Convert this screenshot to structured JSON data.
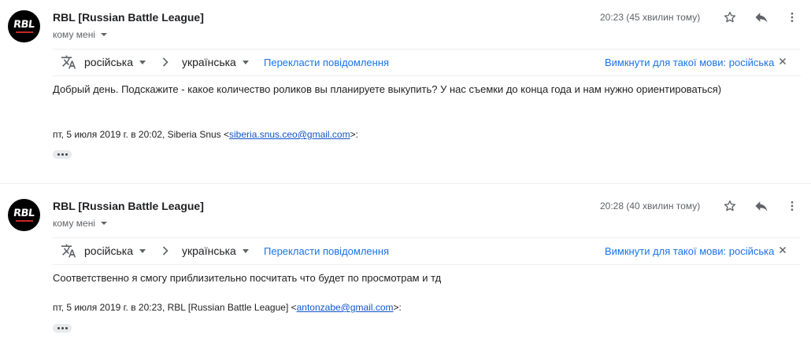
{
  "messages": [
    {
      "sender": "RBL [Russian Battle League]",
      "recipient": "кому мені",
      "time": "20:23 (45 хвилин тому)",
      "avatar_logo": "RBL",
      "translation": {
        "source_lang": "російська",
        "target_lang": "українська",
        "translate_label": "Перекласти повідомлення",
        "disable_label": "Вимкнути для такої мови: російська"
      },
      "body": "Добрый день. Подскажите - какое количество роликов вы планируете выкупить? У нас съемки до конца года и нам нужно ориентироваться)",
      "quote_prefix": "пт, 5 июля 2019 г. в 20:02, Siberia Snus <",
      "quote_email": "siberia.snus.ceo@gmail.com",
      "quote_suffix": ">:"
    },
    {
      "sender": "RBL [Russian Battle League]",
      "recipient": "кому мені",
      "time": "20:28 (40 хвилин тому)",
      "avatar_logo": "RBL",
      "translation": {
        "source_lang": "російська",
        "target_lang": "українська",
        "translate_label": "Перекласти повідомлення",
        "disable_label": "Вимкнути для такої мови: російська"
      },
      "body": "Соответственно я смогу приблизительно посчитать что будет по просмотрам и тд",
      "quote_prefix": "пт, 5 июля 2019 г. в 20:23, RBL [Russian Battle League] <",
      "quote_email": "antonzabe@gmail.com",
      "quote_suffix": ">:"
    }
  ],
  "icons": {
    "star": "star-icon",
    "reply": "reply-icon",
    "more": "more-vert-icon",
    "translate": "translate-icon",
    "arrow": "chevron-right-icon",
    "close": "close-icon",
    "ellipsis": "ellipsis-icon"
  },
  "colors": {
    "link": "#1a73e8",
    "email_link": "#1155cc",
    "secondary_text": "#5f6368",
    "avatar_bg": "#000000"
  }
}
